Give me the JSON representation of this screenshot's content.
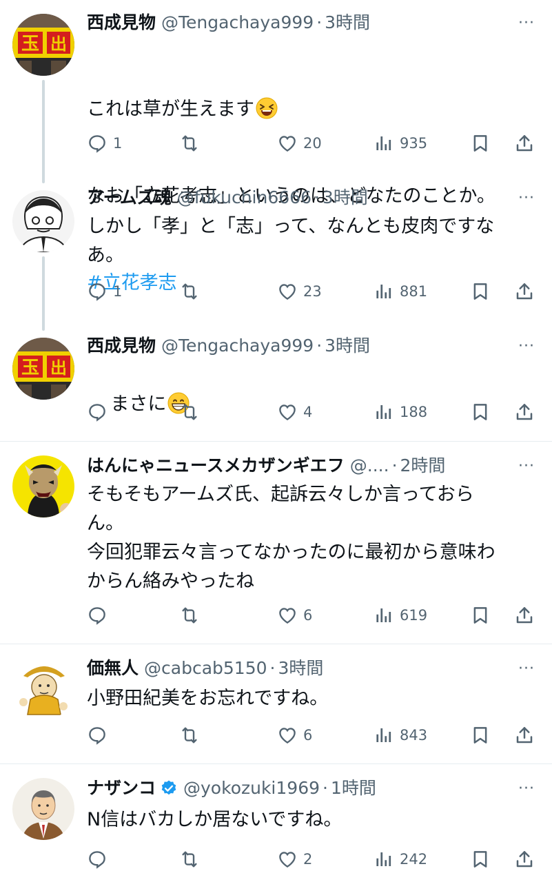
{
  "tweets": [
    {
      "name": "西成見物",
      "handle": "@Tengachaya999",
      "dot": "·",
      "time": "3時間",
      "more": "···",
      "text_lines": [
        "これは草が生えます",
        "なお「立花考志」というのは、どなたのことか。"
      ],
      "emoji": "laughing-face",
      "hashtag": "#立花孝志",
      "replies": "1",
      "retweets": "",
      "likes": "20",
      "views": "935"
    },
    {
      "name": "アームズ魂",
      "handle": "@fukuchin6666",
      "dot": "·",
      "time": "3時間",
      "more": "···",
      "text": "しかし「孝」と「志」って、なんとも皮肉ですな\nあ。",
      "replies": "1",
      "retweets": "",
      "likes": "23",
      "views": "881"
    },
    {
      "name": "西成見物",
      "handle": "@Tengachaya999",
      "dot": "·",
      "time": "3時間",
      "more": "···",
      "text": "まさに",
      "emoji": "grinning-face",
      "replies": "",
      "retweets": "",
      "likes": "4",
      "views": "188"
    },
    {
      "name": "はんにゃニュースメカザンギエフ",
      "handle": "@....",
      "dot": "·",
      "time": "2時間",
      "more": "···",
      "text": "そもそもアームズ氏、起訴云々しか言っておら\nん。\n今回犯罪云々言ってなかったのに最初から意味わ\nからん絡みやったね",
      "replies": "",
      "retweets": "",
      "likes": "6",
      "views": "619"
    },
    {
      "name": "価無人",
      "handle": "@cabcab5150",
      "dot": "·",
      "time": "3時間",
      "more": "···",
      "text": "小野田紀美をお忘れですね。",
      "replies": "",
      "retweets": "",
      "likes": "6",
      "views": "843"
    },
    {
      "name": "ナザンコ",
      "verified": true,
      "handle": "@yokozuki1969",
      "dot": "·",
      "time": "1時間",
      "more": "···",
      "text": "N信はバカしか居ないですね。",
      "replies": "",
      "retweets": "",
      "likes": "2",
      "views": "242"
    }
  ],
  "colors": {
    "text": "#0f1419",
    "secondary": "#536471",
    "link": "#1d9bf0",
    "verified": "#1d9bf0",
    "divider": "#e6ecf0",
    "thread_line": "#cfd9de"
  }
}
